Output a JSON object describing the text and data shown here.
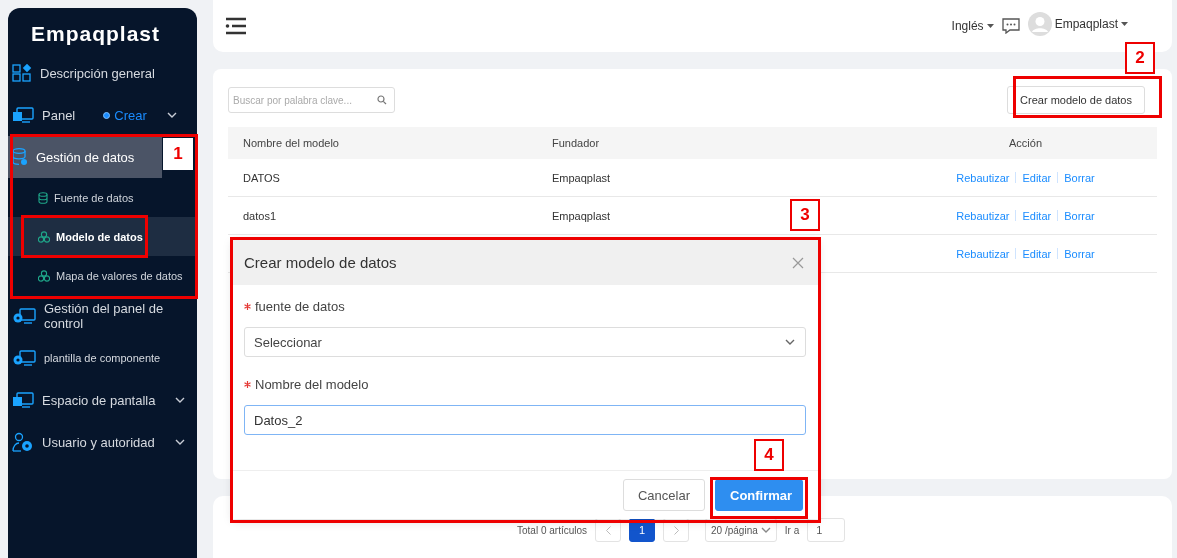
{
  "sidebar": {
    "logo": "Empaqplast",
    "items": [
      {
        "label": "Descripción general",
        "kind": "overview",
        "selected": false,
        "chevron": false
      },
      {
        "label": "Panel",
        "kind": "monitor",
        "selected": false,
        "chevron": true,
        "badge": "Crear"
      },
      {
        "label": "Gestión de datos",
        "kind": "database",
        "selected": true,
        "chevron": false,
        "children": [
          {
            "label": "Fuente de datos",
            "kind": "database",
            "selected": false
          },
          {
            "label": "Modelo de datos",
            "kind": "cluster",
            "selected": true
          },
          {
            "label": "Mapa de valores de datos",
            "kind": "cluster",
            "selected": false
          }
        ]
      },
      {
        "label": "Gestión del panel de control",
        "kind": "monitor-gear",
        "selected": false,
        "chevron": false
      },
      {
        "label": "plantilla de componente",
        "kind": "monitor-gear",
        "selected": false,
        "chevron": false,
        "small": true
      },
      {
        "label": "Espacio de pantalla",
        "kind": "monitor",
        "selected": false,
        "chevron": true
      },
      {
        "label": "Usuario y autoridad",
        "kind": "user-gear",
        "selected": false,
        "chevron": true
      }
    ]
  },
  "header": {
    "language": "Inglés",
    "user": "Empaqplast"
  },
  "toolbar": {
    "search": {
      "placeholder": "Buscar por palabra clave..."
    },
    "create_button": "Crear modelo de datos"
  },
  "table": {
    "columns": [
      "Nombre del modelo",
      "Fundador",
      "Acción"
    ],
    "rows": [
      {
        "cells": [
          "DATOS",
          "Empaqplast"
        ],
        "actions": [
          "Rebautizar",
          "Editar",
          "Borrar"
        ]
      },
      {
        "cells": [
          "datos1",
          "Empaqplast"
        ],
        "actions": [
          "Rebautizar",
          "Editar",
          "Borrar"
        ]
      },
      {
        "actions": [
          "Rebautizar",
          "Editar",
          "Borrar"
        ]
      }
    ]
  },
  "dialog": {
    "title": "Crear modelo de datos",
    "fields": [
      {
        "kind": "select",
        "label": "fuente de datos",
        "required": true,
        "placeholder": "Seleccionar"
      },
      {
        "kind": "input",
        "label": "Nombre del modelo",
        "required": true,
        "value": "Datos_2",
        "focused": true
      }
    ],
    "buttons": [
      {
        "label": "Cancelar",
        "primary": false
      },
      {
        "label": "Confirmar",
        "primary": true
      }
    ]
  },
  "pagination": {
    "total": "Total 0 artículos",
    "pages": [
      {
        "label": "1",
        "selected": true
      }
    ],
    "page_size": "20 /página",
    "goto_label": "Ir a",
    "goto_value": "1"
  },
  "annotations": [
    {
      "label": "1"
    },
    {
      "label": "2"
    },
    {
      "label": "3"
    },
    {
      "label": "4"
    }
  ]
}
